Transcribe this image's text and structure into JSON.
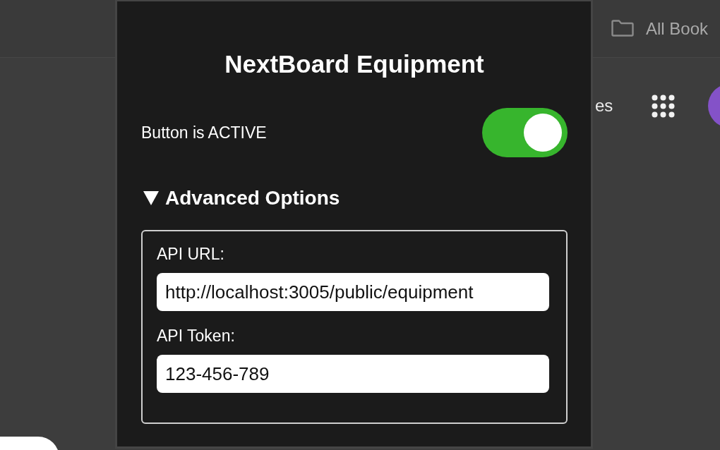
{
  "bookmarks_bar": {
    "folder_label": "All Book"
  },
  "header": {
    "partial_text": "es"
  },
  "popup": {
    "title": "NextBoard Equipment",
    "toggle": {
      "label": "Button is ACTIVE",
      "on": true
    },
    "advanced": {
      "label": "Advanced Options",
      "expanded": true,
      "fields": [
        {
          "label": "API URL:",
          "value": "http://localhost:3005/public/equipment"
        },
        {
          "label": "API Token:",
          "value": "123-456-789"
        }
      ]
    }
  }
}
